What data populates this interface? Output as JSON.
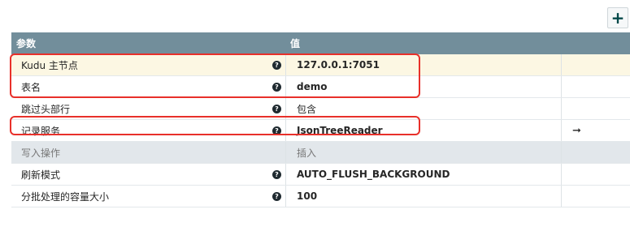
{
  "toolbar": {
    "add_label": "+"
  },
  "table": {
    "header": {
      "name": "参数",
      "value": "值"
    },
    "rows": [
      {
        "name": "Kudu 主节点",
        "value": "127.0.0.1:7051",
        "help": "?"
      },
      {
        "name": "表名",
        "value": "demo",
        "help": "?"
      },
      {
        "name": "跳过头部行",
        "value": "包含",
        "help": "?"
      },
      {
        "name": "记录服务",
        "value": "JsonTreeReader",
        "help": "?",
        "action": "➞"
      },
      {
        "name": "写入操作",
        "value": "插入",
        "help": ""
      },
      {
        "name": "刷新模式",
        "value": "AUTO_FLUSH_BACKGROUND",
        "help": "?"
      },
      {
        "name": "分批处理的容量大小",
        "value": "100",
        "help": "?"
      }
    ]
  },
  "colors": {
    "header_bg": "#728e9b",
    "highlight_bg": "#fcf7e3",
    "disabled_bg": "#e2e7eb",
    "annotation_red": "#e8302a",
    "add_icon": "#004849"
  }
}
